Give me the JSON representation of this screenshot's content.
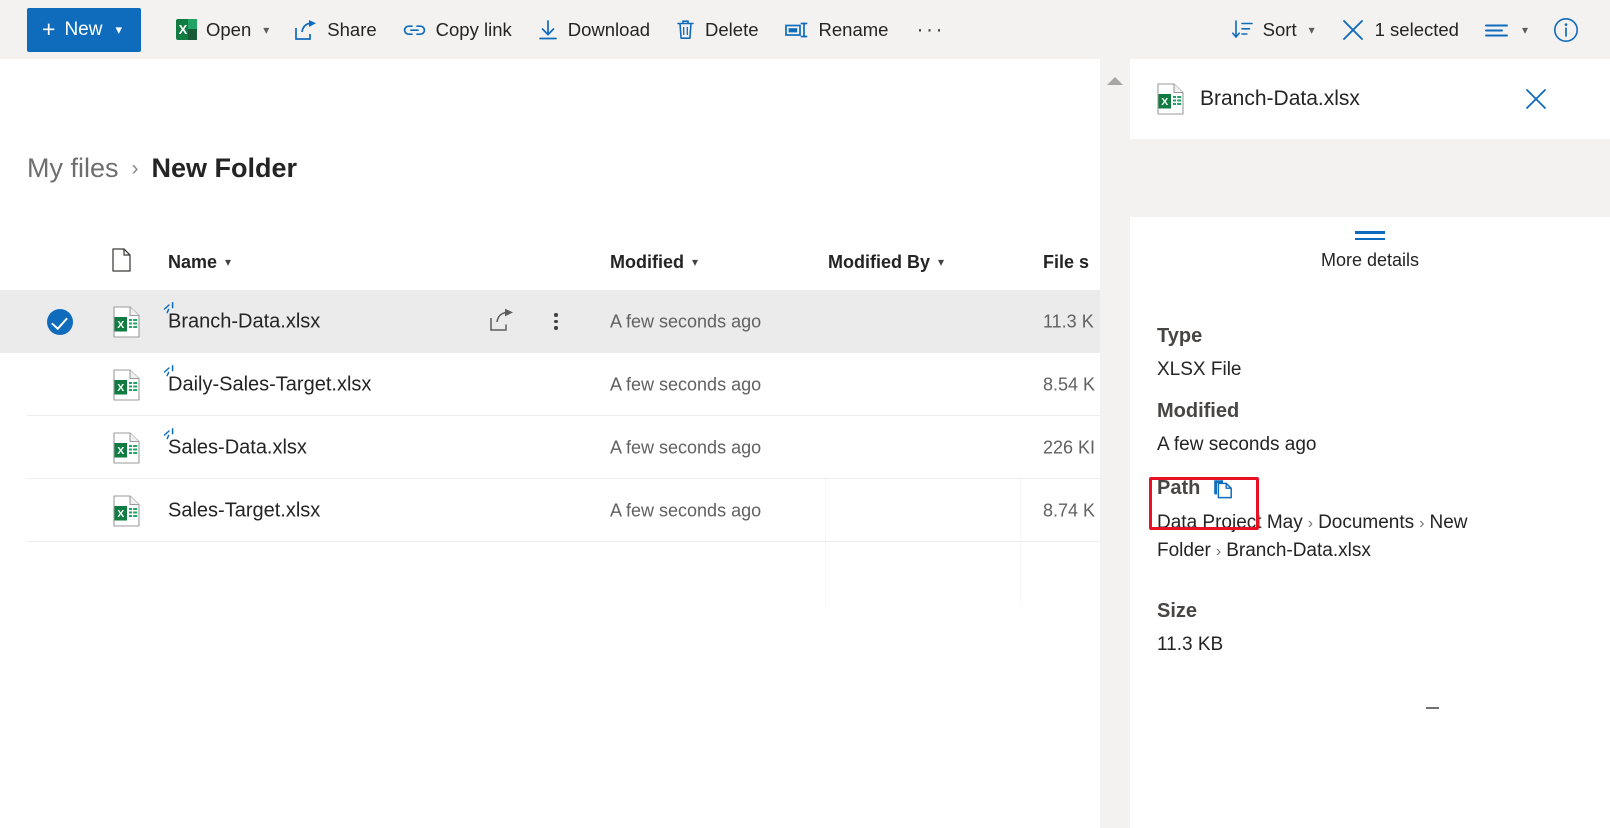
{
  "commandbar": {
    "new_button": {
      "label": "New",
      "icon": "plus-icon",
      "chevron": "chevron-down-icon"
    },
    "items": [
      {
        "label": "Open",
        "icon": "excel-icon",
        "has_chevron": true
      },
      {
        "label": "Share",
        "icon": "share-icon",
        "has_chevron": false
      },
      {
        "label": "Copy link",
        "icon": "link-icon",
        "has_chevron": false
      },
      {
        "label": "Download",
        "icon": "download-icon",
        "has_chevron": false
      },
      {
        "label": "Delete",
        "icon": "trash-icon",
        "has_chevron": false
      },
      {
        "label": "Rename",
        "icon": "rename-icon",
        "has_chevron": false
      }
    ],
    "overflow_label": "···",
    "sort": {
      "label": "Sort",
      "icon": "sort-icon",
      "chevron": "chevron-down-icon"
    },
    "selection": {
      "label": "1 selected",
      "icon": "close-x-icon"
    },
    "view_options": {
      "icon": "view-list-icon",
      "chevron": "chevron-down-icon"
    },
    "info": {
      "icon": "info-icon"
    }
  },
  "breadcrumb": {
    "root": "My files",
    "separator": "›",
    "current": "New Folder"
  },
  "file_list": {
    "columns": [
      {
        "key": "filetype",
        "label": "",
        "sortable": false
      },
      {
        "key": "name",
        "label": "Name",
        "sortable": true
      },
      {
        "key": "modified",
        "label": "Modified",
        "sortable": true
      },
      {
        "key": "modifiedby",
        "label": "Modified By",
        "sortable": true
      },
      {
        "key": "size",
        "label": "File s",
        "sortable": true
      }
    ],
    "rows": [
      {
        "name": "Branch-Data.xlsx",
        "modified": "A few seconds ago",
        "modified_by": "",
        "size": "11.3 K",
        "selected": true,
        "new_badge": true,
        "icon": "excel-file-icon"
      },
      {
        "name": "Daily-Sales-Target.xlsx",
        "modified": "A few seconds ago",
        "modified_by": "",
        "size": "8.54 K",
        "selected": false,
        "new_badge": true,
        "icon": "excel-file-icon"
      },
      {
        "name": "Sales-Data.xlsx",
        "modified": "A few seconds ago",
        "modified_by": "",
        "size": "226 KI",
        "selected": false,
        "new_badge": true,
        "icon": "excel-file-icon"
      },
      {
        "name": "Sales-Target.xlsx",
        "modified": "A few seconds ago",
        "modified_by": "",
        "size": "8.74 K",
        "selected": false,
        "new_badge": false,
        "icon": "excel-file-icon"
      }
    ]
  },
  "details_panel": {
    "title": "Branch-Data.xlsx",
    "file_icon": "excel-file-icon",
    "close_icon": "close-x-icon",
    "expander": {
      "label": "More details",
      "icon": "equals-icon"
    },
    "fields": {
      "type": {
        "label": "Type",
        "value": "XLSX File"
      },
      "modified": {
        "label": "Modified",
        "value": "A few seconds ago"
      },
      "path": {
        "label": "Path",
        "copy_icon": "copy-icon",
        "crumbs": [
          "Data Project May",
          "Documents",
          "New Folder",
          "Branch-Data.xlsx"
        ],
        "separator": "›"
      },
      "size": {
        "label": "Size",
        "value": "11.3 KB"
      }
    }
  },
  "scrollbar": {
    "up_arrow_icon": "caret-up-icon"
  },
  "colors": {
    "accent_blue": "#0f6cbd",
    "excel_green": "#107c41",
    "highlight_red": "#e81123",
    "commandbar_bg": "#f3f2f1",
    "selected_row_bg": "#ebebeb"
  }
}
